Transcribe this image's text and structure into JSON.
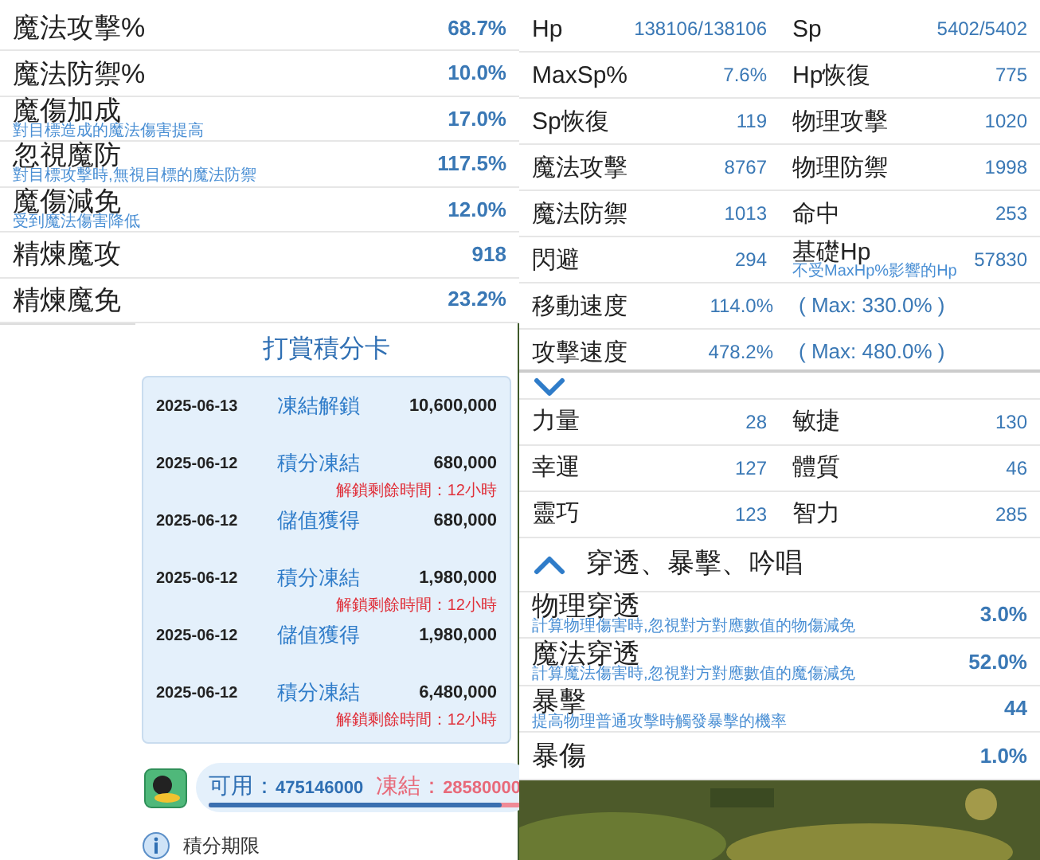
{
  "magic_stats": {
    "rows": [
      {
        "label": "魔法攻擊%",
        "value": "68.7%"
      },
      {
        "label": "魔法防禦%",
        "value": "10.0%"
      },
      {
        "label": "魔傷加成",
        "description": "對目標造成的魔法傷害提高",
        "value": "17.0%"
      },
      {
        "label": "忽視魔防",
        "description": "對目標攻擊時,無視目標的魔法防禦",
        "value": "117.5%"
      },
      {
        "label": "魔傷減免",
        "description": "受到魔法傷害降低",
        "value": "12.0%"
      },
      {
        "label": "精煉魔攻",
        "value": "918"
      },
      {
        "label": "精煉魔免",
        "value": "23.2%"
      }
    ]
  },
  "reward_card": {
    "title": "打賞積分卡",
    "entries": [
      {
        "date": "2025-06-13",
        "type": "凍結解鎖",
        "amount": "10,600,000"
      },
      {
        "date": "2025-06-12",
        "type": "積分凍結",
        "amount": "680,000",
        "note": "解鎖剩餘時間：12小時"
      },
      {
        "date": "2025-06-12",
        "type": "儲值獲得",
        "amount": "680,000"
      },
      {
        "date": "2025-06-12",
        "type": "積分凍結",
        "amount": "1,980,000",
        "note": "解鎖剩餘時間：12小時"
      },
      {
        "date": "2025-06-12",
        "type": "儲值獲得",
        "amount": "1,980,000"
      },
      {
        "date": "2025-06-12",
        "type": "積分凍結",
        "amount": "6,480,000",
        "note": "解鎖剩餘時間：12小時"
      }
    ],
    "available_label": "可用：",
    "available": "475146000",
    "frozen_label": "凍結：",
    "frozen": "28580000",
    "level": 0.94,
    "footer_link": "積分期限"
  },
  "basic_stats": {
    "rows": [
      [
        {
          "kind": "stat",
          "label": "Hp",
          "value": "138106/138106"
        },
        {
          "kind": "stat",
          "label": "Sp",
          "value": "5402/5402"
        }
      ],
      [
        {
          "kind": "stat",
          "label": "MaxSp%",
          "value": "7.6%"
        },
        {
          "kind": "stat",
          "label": "Hp恢復",
          "value": "775"
        }
      ],
      [
        {
          "kind": "stat",
          "label": "Sp恢復",
          "value": "119"
        },
        {
          "kind": "stat",
          "label": "物理攻擊",
          "value": "1020"
        }
      ],
      [
        {
          "kind": "stat",
          "label": "魔法攻擊",
          "value": "8767"
        },
        {
          "kind": "stat",
          "label": "物理防禦",
          "value": "1998"
        }
      ],
      [
        {
          "kind": "stat",
          "label": "魔法防禦",
          "value": "1013"
        },
        {
          "kind": "stat",
          "label": "命中",
          "value": "253"
        }
      ],
      [
        {
          "kind": "stat",
          "label": "閃避",
          "value": "294"
        },
        {
          "kind": "stat",
          "label": "基礎Hp",
          "description": "不受MaxHp%影響的Hp",
          "value": "57830"
        }
      ],
      [
        {
          "kind": "stat",
          "label": "移動速度",
          "value": "114.0%"
        },
        {
          "kind": "limit",
          "note": "( Max: 330.0% )"
        }
      ],
      [
        {
          "kind": "stat",
          "label": "攻擊速度",
          "value": "478.2%"
        },
        {
          "kind": "limit",
          "note": "( Max: 480.0% )"
        }
      ]
    ]
  },
  "attributes": {
    "expanded": false,
    "rows": [
      [
        {
          "label": "力量",
          "value": "28"
        },
        {
          "label": "敏捷",
          "value": "130"
        }
      ],
      [
        {
          "label": "幸運",
          "value": "127"
        },
        {
          "label": "體質",
          "value": "46"
        }
      ],
      [
        {
          "label": "靈巧",
          "value": "123"
        },
        {
          "label": "智力",
          "value": "285"
        }
      ]
    ]
  },
  "penetration_section": {
    "title": "穿透、暴擊、吟唱",
    "expanded": true,
    "rows": [
      {
        "label": "物理穿透",
        "description": "計算物理傷害時,忽視對方對應數值的物傷減免",
        "value": "3.0%"
      },
      {
        "label": "魔法穿透",
        "description": "計算魔法傷害時,忽視對方對應數值的魔傷減免",
        "value": "52.0%"
      },
      {
        "label": "暴擊",
        "description": "提高物理普通攻擊時觸發暴擊的機率",
        "value": "44"
      },
      {
        "label": "暴傷",
        "value": "1.0%"
      }
    ]
  }
}
